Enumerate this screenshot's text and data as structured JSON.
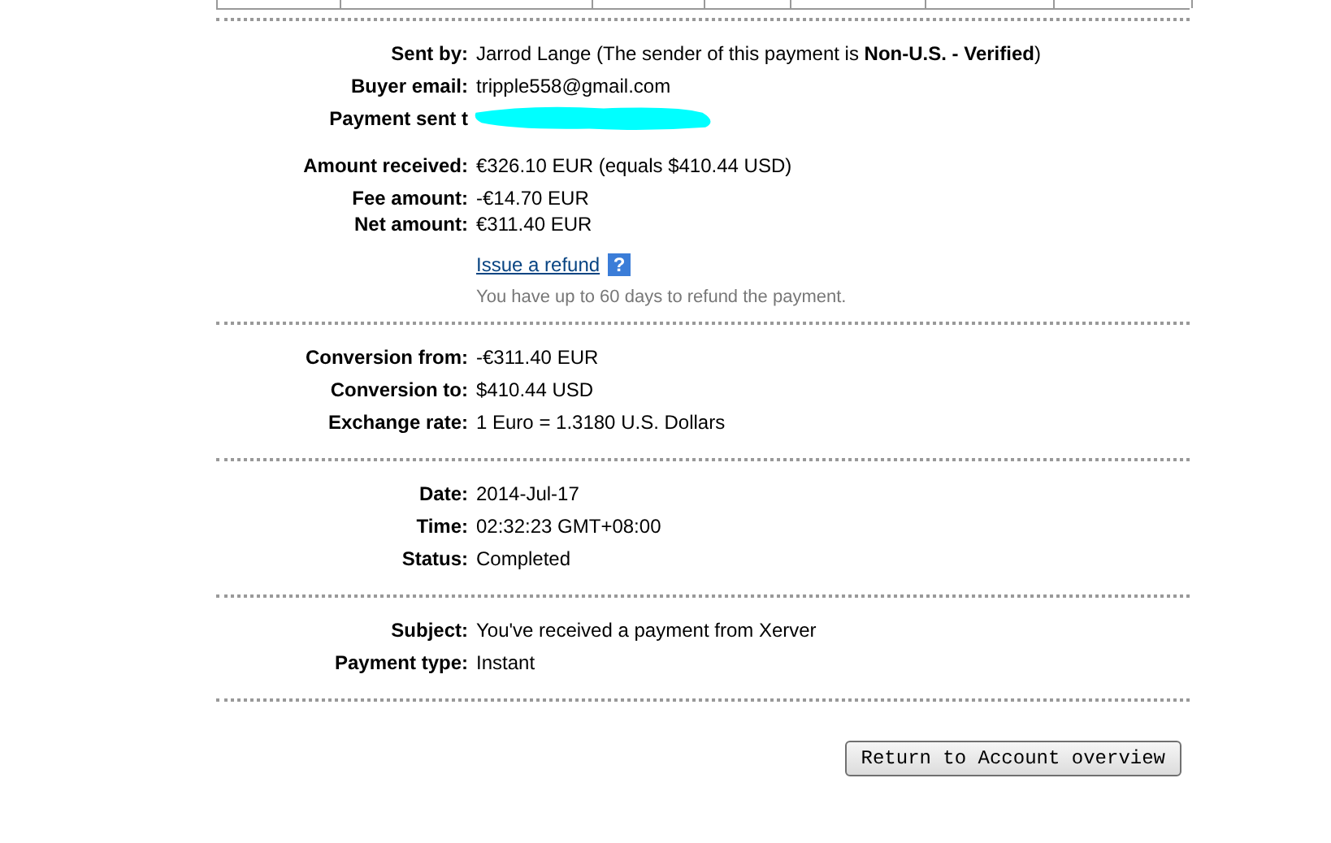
{
  "sections": [
    {
      "fields": [
        {
          "kind": "field",
          "label": "Sent by:",
          "value": "Jarrod Lange (The sender of this payment is **Non-U.S. - Verified**)"
        },
        {
          "kind": "field",
          "label": "Buyer email:",
          "value": "tripple558@gmail.com"
        },
        {
          "kind": "redacted",
          "label": "Payment sent t"
        },
        {
          "kind": "field",
          "label": "Amount received:",
          "value": "€326.10 EUR (equals $410.44 USD)"
        },
        {
          "kind": "field",
          "label": "Fee amount:",
          "value": "-€14.70 EUR"
        },
        {
          "kind": "field",
          "label": "Net amount:",
          "value": "€311.40 EUR"
        }
      ],
      "refund": {
        "link": "Issue a refund",
        "help": "?",
        "note": "You have up to 60 days to refund the payment."
      }
    },
    {
      "fields": [
        {
          "kind": "field",
          "label": "Conversion from:",
          "value": "-€311.40 EUR"
        },
        {
          "kind": "field",
          "label": "Conversion to:",
          "value": "$410.44 USD"
        },
        {
          "kind": "field",
          "label": "Exchange rate:",
          "value": "1 Euro = 1.3180 U.S. Dollars"
        }
      ]
    },
    {
      "fields": [
        {
          "kind": "field",
          "label": "Date:",
          "value": "2014-Jul-17"
        },
        {
          "kind": "field",
          "label": "Time:",
          "value": "02:32:23 GMT+08:00"
        },
        {
          "kind": "field",
          "label": "Status:",
          "value": "Completed"
        }
      ]
    },
    {
      "fields": [
        {
          "kind": "field",
          "label": "Subject:",
          "value": "You've received a payment from Xerver"
        },
        {
          "kind": "field",
          "label": "Payment type:",
          "value": "Instant"
        }
      ]
    }
  ],
  "button": "Return to Account overview"
}
